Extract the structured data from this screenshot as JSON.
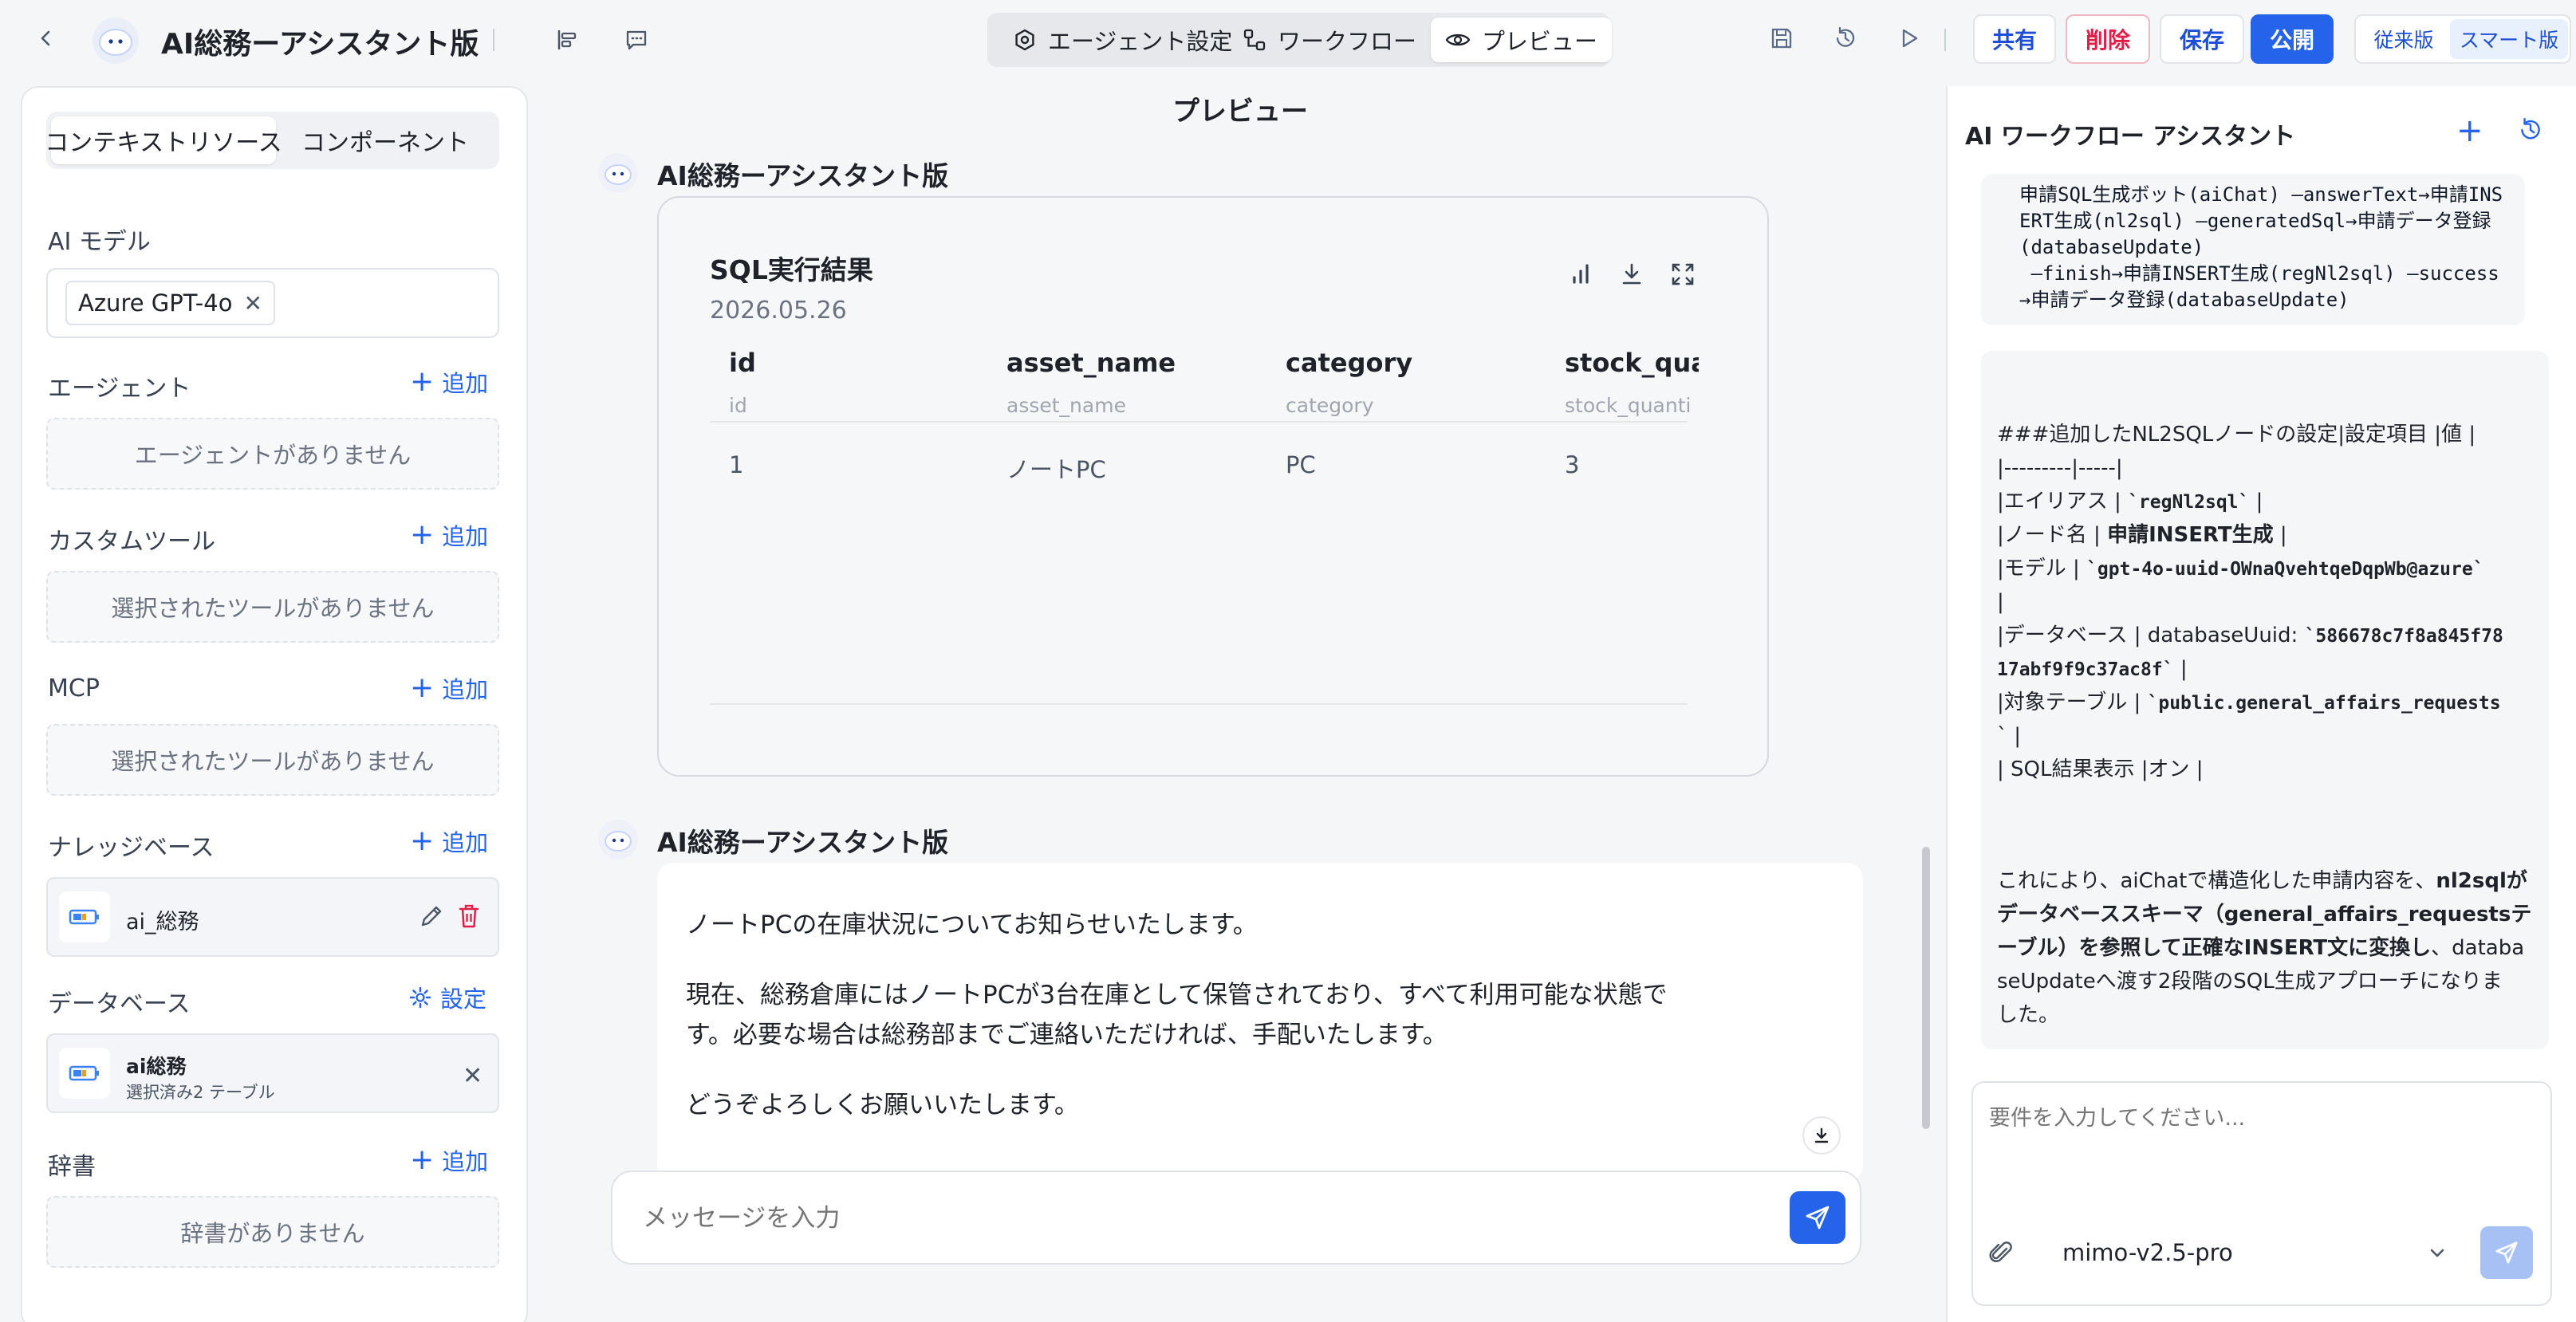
{
  "header": {
    "app_title": "AI総務ーアシスタント版",
    "tabs": [
      {
        "label": "エージェント設定",
        "icon": "hexagon-settings-icon"
      },
      {
        "label": "ワークフロー",
        "icon": "workflow-icon"
      },
      {
        "label": "プレビュー",
        "icon": "eye-icon",
        "active": true
      }
    ],
    "buttons": {
      "share": "共有",
      "delete": "削除",
      "save": "保存",
      "publish": "公開"
    },
    "modes": {
      "legacy": "従来版",
      "smart": "スマート版"
    }
  },
  "left": {
    "tabs": {
      "context": "コンテキストリソース",
      "component": "コンポーネント"
    },
    "ai_model": {
      "title": "AI モデル",
      "selected": "Azure GPT-4o"
    },
    "agent": {
      "title": "エージェント",
      "add": "追加",
      "empty": "エージェントがありません"
    },
    "custom_tool": {
      "title": "カスタムツール",
      "add": "追加",
      "empty": "選択されたツールがありません"
    },
    "mcp": {
      "title": "MCP",
      "add": "追加",
      "empty": "選択されたツールがありません"
    },
    "knowledge": {
      "title": "ナレッジベース",
      "add": "追加",
      "item": "ai_総務"
    },
    "database": {
      "title": "データベース",
      "settings": "設定",
      "item_name": "ai総務",
      "item_sub": "選択済み2 テーブル"
    },
    "dictionary": {
      "title": "辞書",
      "add": "追加",
      "empty": "辞書がありません"
    }
  },
  "center": {
    "title": "プレビュー",
    "bot_name": "AI総務ーアシスタント版",
    "sql": {
      "title": "SQL実行結果",
      "date": "2026.05.26",
      "columns": [
        {
          "name": "id",
          "sub": "id"
        },
        {
          "name": "asset_name",
          "sub": "asset_name"
        },
        {
          "name": "category",
          "sub": "category"
        },
        {
          "name": "stock_qua",
          "sub": "stock_quanti"
        }
      ],
      "rows": [
        [
          "1",
          "ノートPC",
          "PC",
          "3"
        ]
      ]
    },
    "message": {
      "p1": "ノートPCの在庫状況についてお知らせいたします。",
      "p2a": "現在、総務倉庫にはノートPCが3台在庫として保管されており、すべて利用可能な状態で",
      "p2b": "す。必要な場合は総務部までご連絡いただければ、手配いたします。",
      "p3": "どうぞよろしくお願いいたします。"
    },
    "input_placeholder": "メッセージを入力"
  },
  "right": {
    "title": "AI ワークフロー アシスタント",
    "code_lines": [
      "申請SQL生成ボット(aiChat) —answerText→申請INS",
      "ERT生成(nl2sql) —generatedSql→申請データ登録",
      "(databaseUpdate)",
      " —finish→申請INSERT生成(regNl2sql) —success",
      "→申請データ登録(databaseUpdate)"
    ],
    "md": {
      "l1": "###追加したNL2SQLノードの設定|設定項目 |値 |",
      "l2": "|---------|-----|",
      "l3a": "|エイリアス | ",
      "l3b": "`regNl2sql`",
      "l3c": " |",
      "l4a": "|ノード名 | ",
      "l4b": "申請INSERT生成",
      "l4c": " |",
      "l5a": "|モデル | ",
      "l5b": "`gpt-4o-uuid-OWnaQvehtqeDqpWb@azure`",
      "l6": "|",
      "l7a": "|データベース | databaseUuid: ",
      "l7b": "`586678c7f8a845f78",
      "l8a": "17abf9f9c37ac8f`",
      "l8b": " |",
      "l9a": "|対象テーブル | ",
      "l9b": "`public.general_affairs_requests",
      "l10": "` |",
      "l11": "| SQL結果表示 |オン |",
      "p1a": "これにより、aiChatで構造化した申請内容を、",
      "p1b": "nl2sqlが",
      "p2": "データベーススキーマ（general_affairs_requestsテ",
      "p3a": "ーブル）を参照して正確なINSERT文に変換し",
      "p3b": "、databa",
      "p4": "seUpdateへ渡す2段階のSQL生成アプローチになりま",
      "p5": "した。"
    },
    "input_placeholder": "要件を入力してください...",
    "model": "mimo-v2.5-pro"
  }
}
